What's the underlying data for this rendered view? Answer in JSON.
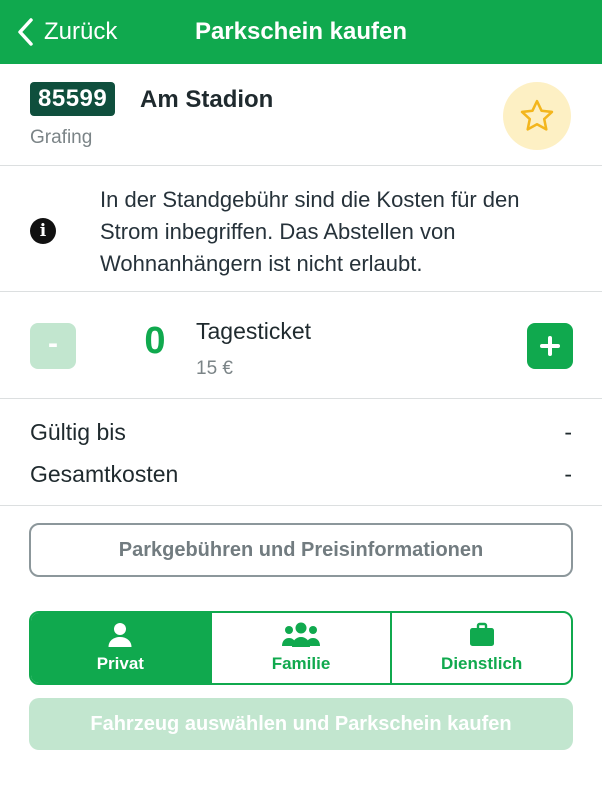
{
  "nav": {
    "back_label": "Zurück",
    "title": "Parkschein kaufen"
  },
  "zone": {
    "number": "85599",
    "name": "Am Stadion",
    "city": "Grafing",
    "favorite": false
  },
  "info": {
    "icon": "info-icon",
    "text": "In der Standgebühr sind die Kosten für den Strom inbegriffen. Das Abstellen von Wohnanhängern ist nicht erlaubt."
  },
  "ticket": {
    "minus_label": "-",
    "quantity": "0",
    "name": "Tagesticket",
    "price": "15 €"
  },
  "summary": {
    "valid_until_label": "Gültig bis",
    "valid_until_value": "-",
    "total_label": "Gesamtkosten",
    "total_value": "-"
  },
  "price_info_button": "Parkgebühren und Preisinformationen",
  "usage": {
    "options": [
      {
        "label": "Privat",
        "icon": "person-icon",
        "selected": true
      },
      {
        "label": "Familie",
        "icon": "family-icon",
        "selected": false
      },
      {
        "label": "Dienstlich",
        "icon": "briefcase-icon",
        "selected": false
      }
    ]
  },
  "buy_button": "Fahrzeug auswählen und Parkschein kaufen",
  "colors": {
    "brand_green": "#10a94e",
    "zone_badge": "#0f4f3d",
    "disabled_green": "#c2e6cf",
    "favorite_bg": "#fdf0c4",
    "star": "#f3b61d"
  }
}
